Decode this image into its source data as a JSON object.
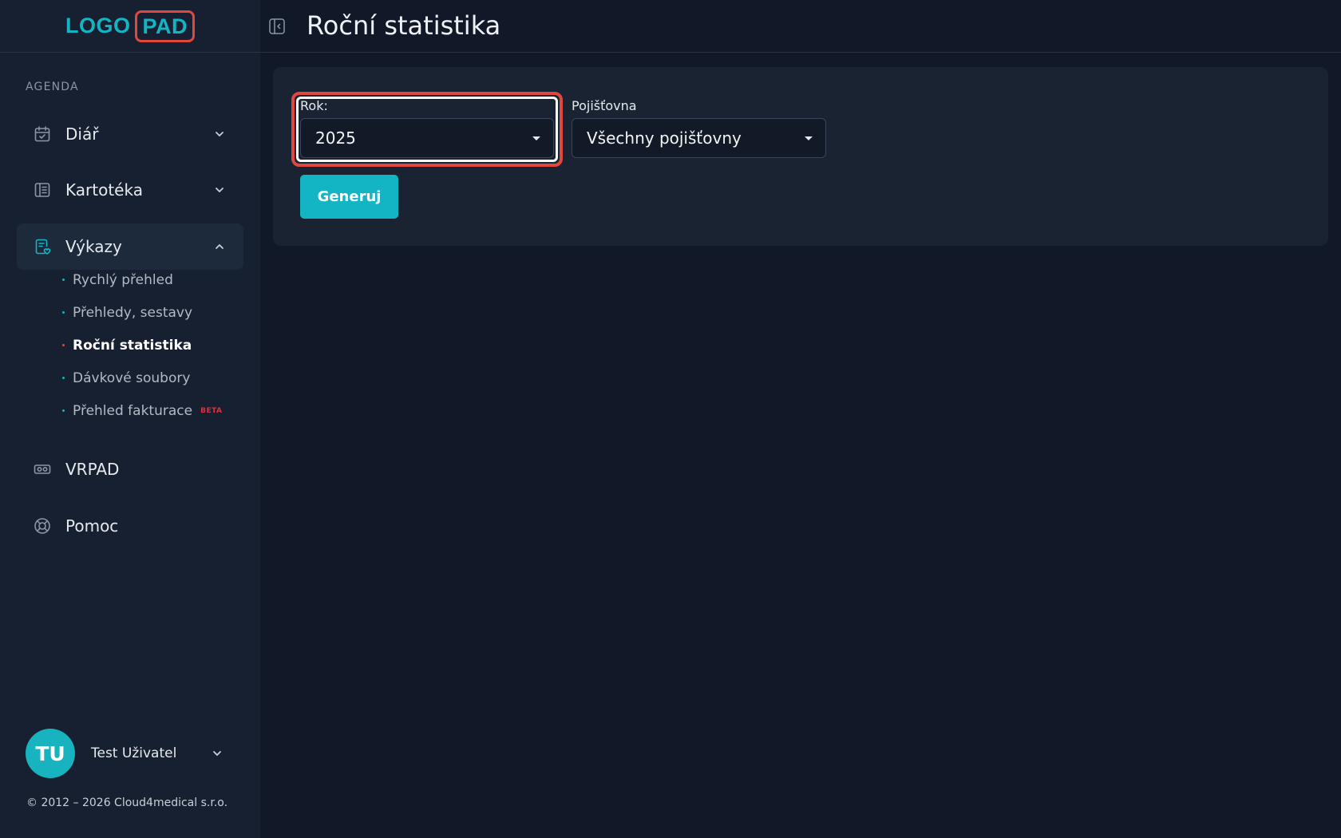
{
  "logo": {
    "left": "LOGO",
    "right": "PAD"
  },
  "sidebar": {
    "section_label": "AGENDA",
    "items": [
      {
        "label": "Diář",
        "icon": "calendar-check-icon",
        "expanded": false
      },
      {
        "label": "Kartotéka",
        "icon": "card-file-icon",
        "expanded": false
      },
      {
        "label": "Výkazy",
        "icon": "report-heart-icon",
        "expanded": true
      },
      {
        "label": "VRPAD",
        "icon": "vr-headset-icon"
      },
      {
        "label": "Pomoc",
        "icon": "lifebuoy-icon"
      }
    ],
    "subitems": [
      {
        "label": "Rychlý přehled"
      },
      {
        "label": "Přehledy, sestavy"
      },
      {
        "label": "Roční statistika",
        "current": true
      },
      {
        "label": "Dávkové soubory"
      },
      {
        "label": "Přehled fakturace",
        "badge": "BETA"
      }
    ],
    "user": {
      "initials": "TU",
      "name": "Test Uživatel"
    },
    "copyright": "© 2012 – 2026 Cloud4medical s.r.o."
  },
  "header": {
    "title": "Roční statistika"
  },
  "form": {
    "year": {
      "label": "Rok:",
      "value": "2025"
    },
    "insurer": {
      "label": "Pojišťovna",
      "value": "Všechny pojišťovny"
    },
    "generate_label": "Generuj"
  },
  "colors": {
    "accent": "#13b5c4",
    "highlight": "#e0473f",
    "background": "#111827",
    "sidebar": "#172030"
  }
}
